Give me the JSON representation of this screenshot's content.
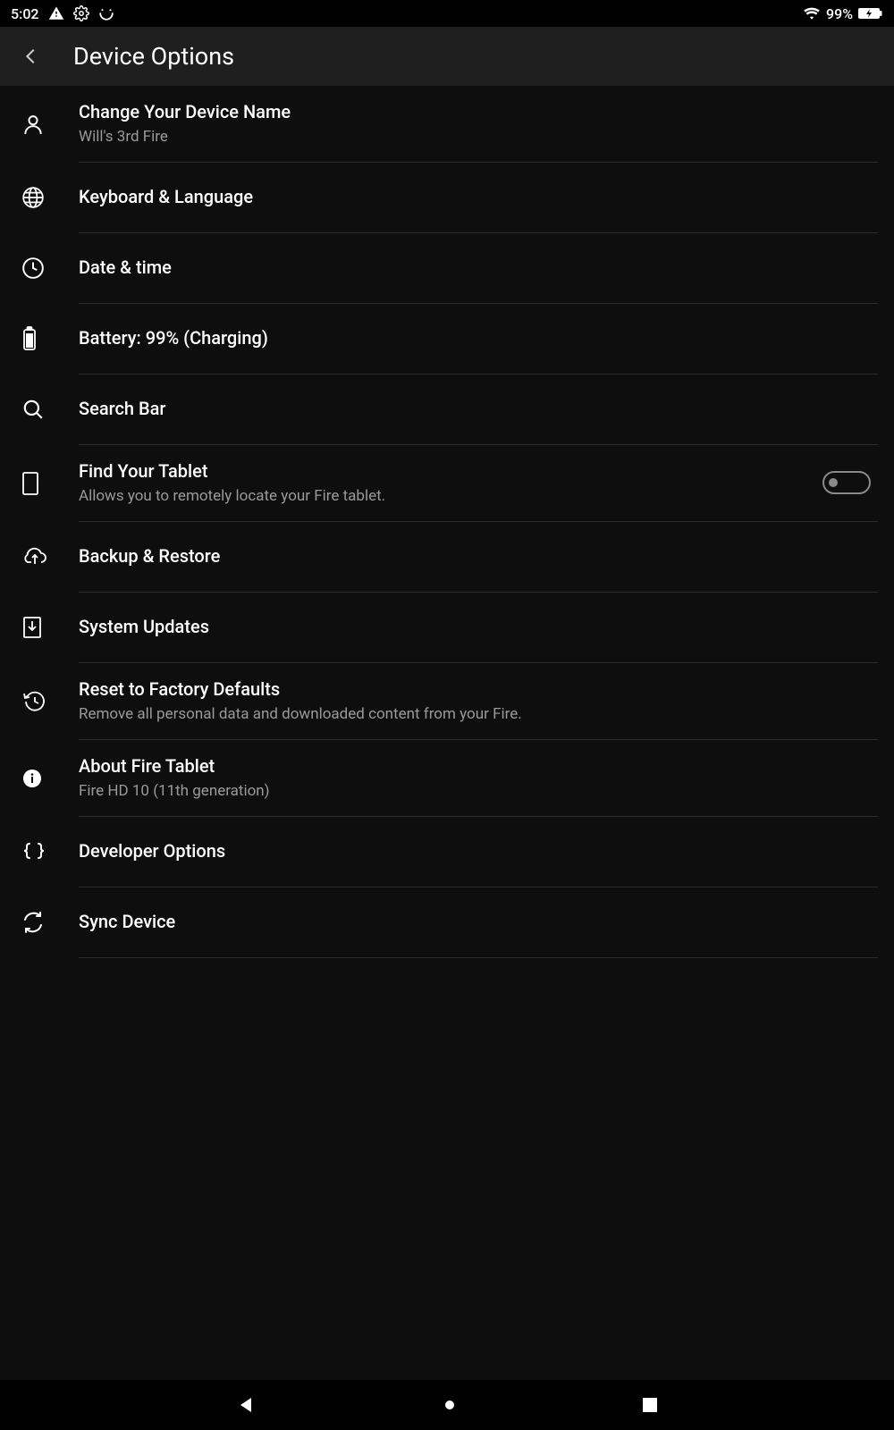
{
  "status": {
    "time": "5:02",
    "battery_pct": "99%"
  },
  "header": {
    "title": "Device Options"
  },
  "rows": {
    "device_name": {
      "title": "Change Your Device Name",
      "sub": "Will's 3rd Fire"
    },
    "keyboard": {
      "title": "Keyboard  & Language"
    },
    "datetime": {
      "title": "Date & time"
    },
    "battery": {
      "title": "Battery: 99% (Charging)"
    },
    "searchbar": {
      "title": "Search Bar"
    },
    "find": {
      "title": "Find Your Tablet",
      "sub": "Allows you to remotely locate your Fire tablet.",
      "toggle": false
    },
    "backup": {
      "title": "Backup & Restore"
    },
    "updates": {
      "title": "System Updates"
    },
    "reset": {
      "title": "Reset to Factory Defaults",
      "sub": "Remove all personal data and downloaded content from your Fire."
    },
    "about": {
      "title": "About Fire Tablet",
      "sub": "Fire HD 10 (11th generation)"
    },
    "developer": {
      "title": "Developer Options"
    },
    "sync": {
      "title": "Sync Device"
    }
  }
}
